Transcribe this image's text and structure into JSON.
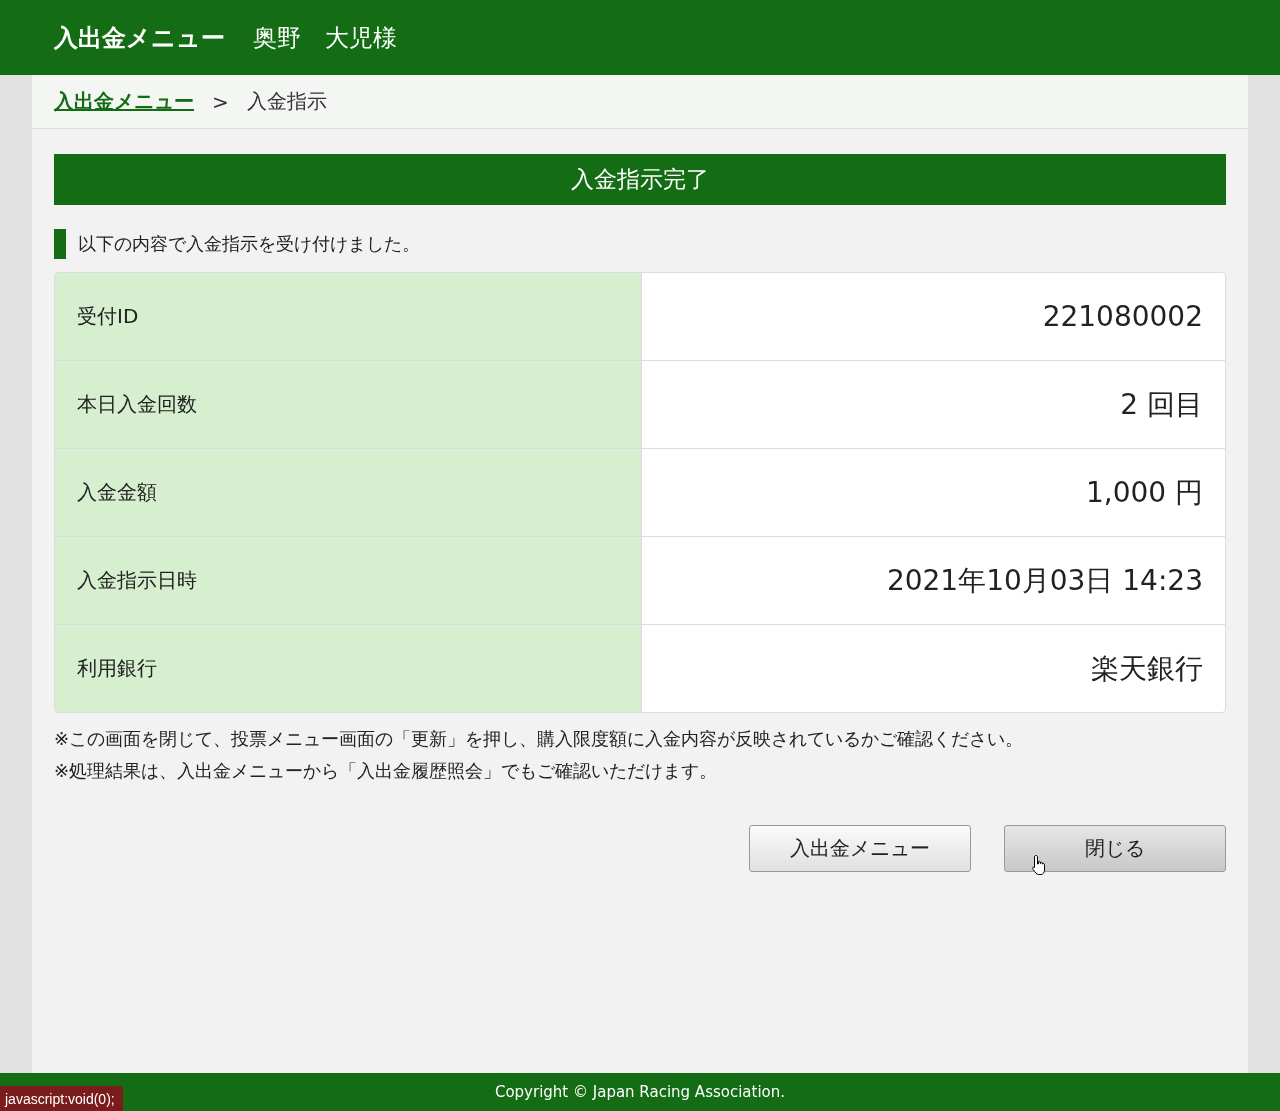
{
  "header": {
    "title": "入出金メニュー",
    "user": "奥野　大児様"
  },
  "breadcrumb": [
    {
      "label": "入出金メニュー",
      "link": true
    },
    {
      "label": ">",
      "link": false
    },
    {
      "label": "入金指示",
      "link": false
    }
  ],
  "section_title": "入金指示完了",
  "message": "以下の内容で入金指示を受け付けました。",
  "table": {
    "rows": [
      {
        "label": "受付ID",
        "value": "221080002"
      },
      {
        "label": "本日入金回数",
        "value": "2 回目"
      },
      {
        "label": "入金金額",
        "value": "1,000 円"
      },
      {
        "label": "入金指示日時",
        "value": "2021年10月03日 14:23"
      },
      {
        "label": "利用銀行",
        "value": "楽天銀行"
      }
    ]
  },
  "notes": [
    "※この画面を閉じて、投票メニュー画面の「更新」を押し、購入限度額に入金内容が反映されているかご確認ください。",
    "※処理結果は、入出金メニューから「入出金履歴照会」でもご確認いただけます。"
  ],
  "buttons": [
    {
      "label": "入出金メニュー",
      "hovered": false
    },
    {
      "label": "閉じる",
      "hovered": true
    }
  ],
  "footer": "Copyright © Japan Racing Association.",
  "status_bar": "javascript:void(0);"
}
